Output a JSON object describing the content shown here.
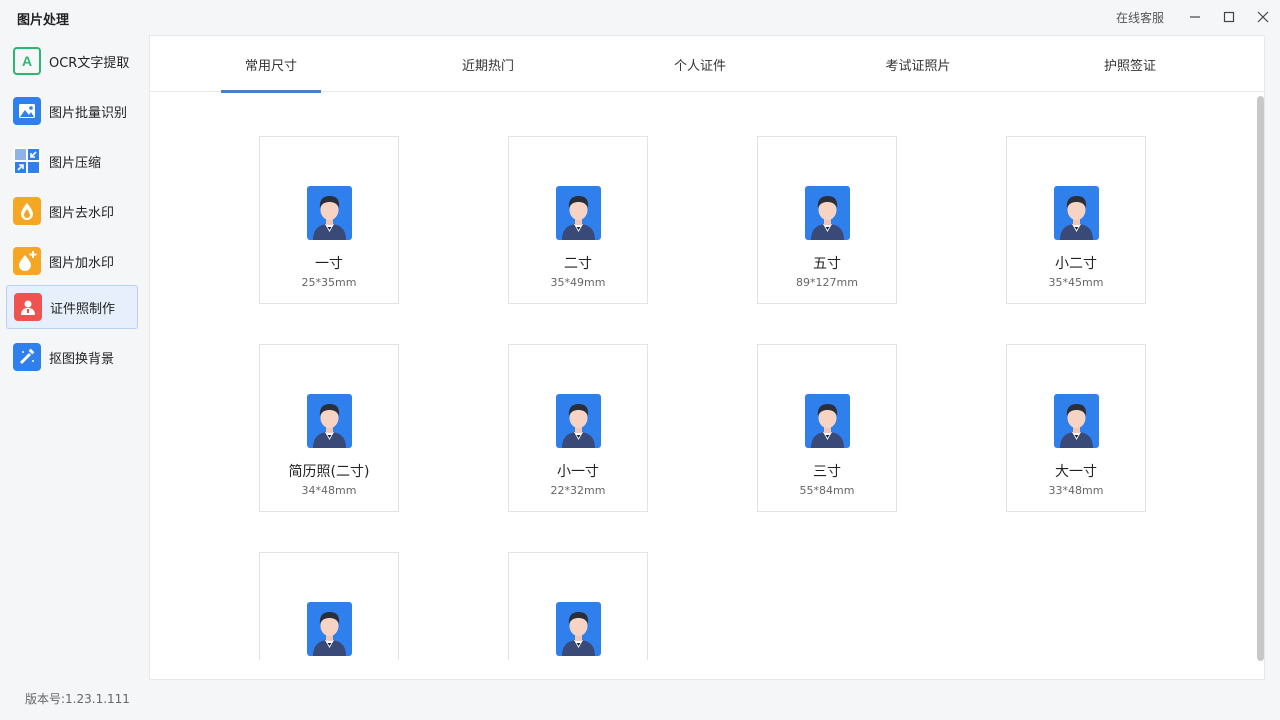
{
  "app": {
    "title": "图片处理",
    "support_label": "在线客服",
    "version": "版本号:1.23.1.111"
  },
  "sidebar": {
    "items": [
      {
        "label": "OCR文字提取",
        "icon": "ocr-icon",
        "color": "#2bb673"
      },
      {
        "label": "图片批量识别",
        "icon": "image-recognition-icon",
        "color": "#2f80ed"
      },
      {
        "label": "图片压缩",
        "icon": "compress-icon",
        "color": "#2f80ed"
      },
      {
        "label": "图片去水印",
        "icon": "remove-watermark-icon",
        "color": "#f5a623"
      },
      {
        "label": "图片加水印",
        "icon": "add-watermark-icon",
        "color": "#f5a623"
      },
      {
        "label": "证件照制作",
        "icon": "id-photo-icon",
        "color": "#ef5350",
        "active": true
      },
      {
        "label": "抠图换背景",
        "icon": "cutout-icon",
        "color": "#2f80ed"
      }
    ]
  },
  "tabs": [
    {
      "label": "常用尺寸",
      "active": true
    },
    {
      "label": "近期热门"
    },
    {
      "label": "个人证件"
    },
    {
      "label": "考试证照片"
    },
    {
      "label": "护照签证"
    }
  ],
  "cards": [
    {
      "name": "一寸",
      "size": "25*35mm"
    },
    {
      "name": "二寸",
      "size": "35*49mm"
    },
    {
      "name": "五寸",
      "size": "89*127mm"
    },
    {
      "name": "小二寸",
      "size": "35*45mm"
    },
    {
      "name": "简历照(二寸)",
      "size": "34*48mm"
    },
    {
      "name": "小一寸",
      "size": "22*32mm"
    },
    {
      "name": "三寸",
      "size": "55*84mm"
    },
    {
      "name": "大一寸",
      "size": "33*48mm"
    },
    {
      "name": "",
      "size": ""
    },
    {
      "name": "",
      "size": ""
    }
  ],
  "colors": {
    "accent": "#4a7fc6",
    "avatar_bg": "#2f80ed",
    "active_nav_bg": "#e6effb"
  }
}
